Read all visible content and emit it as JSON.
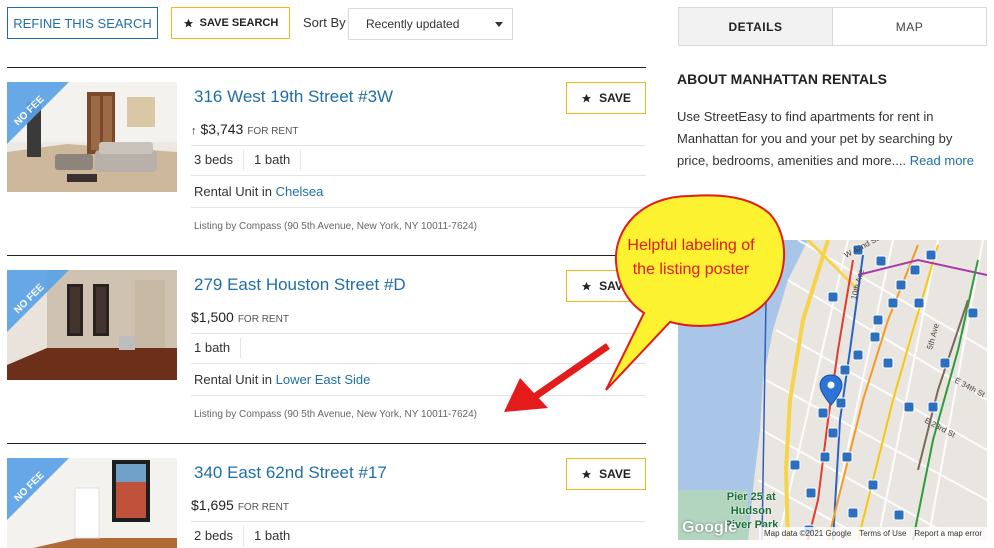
{
  "toolbar": {
    "refine_label": "REFINE THIS SEARCH",
    "save_search_label": "SAVE SEARCH",
    "sort_by_label": "Sort By",
    "sort_selected": "Recently updated"
  },
  "listings": [
    {
      "badge": "NO FEE",
      "title": "316 West 19th Street #3W",
      "price_arrow": "↑",
      "price": "$3,743",
      "price_suffix": "FOR RENT",
      "beds": "3 beds",
      "baths": "1 bath",
      "unit_prefix": "Rental Unit in",
      "neighborhood": "Chelsea",
      "listed_by": "Listing by Compass (90 5th Avenue, New York, NY 10011-7624)",
      "save_label": "SAVE"
    },
    {
      "badge": "NO FEE",
      "title": "279 East Houston Street #D",
      "price": "$1,500",
      "price_suffix": "FOR RENT",
      "baths": "1 bath",
      "unit_prefix": "Rental Unit in",
      "neighborhood": "Lower East Side",
      "listed_by": "Listing by Compass (90 5th Avenue, New York, NY 10011-7624)",
      "save_label": "SAVE"
    },
    {
      "badge": "NO FEE",
      "title": "340 East 62nd Street #17",
      "price": "$1,695",
      "price_suffix": "FOR RENT",
      "beds": "2 beds",
      "baths": "1 bath",
      "save_label": "SAVE"
    }
  ],
  "side": {
    "tabs": [
      {
        "label": "DETAILS",
        "active": true
      },
      {
        "label": "MAP",
        "active": false
      }
    ],
    "about_title": "ABOUT MANHATTAN RENTALS",
    "about_text": "Use StreetEasy to find apartments for rent in Manhattan for you and your pet by searching by price, bedrooms, amenities and more....",
    "read_more": "Read more"
  },
  "map": {
    "place_label_line1": "Pier 25 at",
    "place_label_line2": "Hudson",
    "place_label_line3": "River Park",
    "street_labels": [
      "W 42nd St",
      "10th Ave",
      "5th Ave",
      "E 34th St",
      "E 23rd St"
    ],
    "google_logo": "Google",
    "footer_data": "Map data ©2021 Google",
    "footer_terms": "Terms of Use",
    "footer_report": "Report a map error"
  },
  "annotation": {
    "text": "Helpful labeling of the listing poster"
  },
  "colors": {
    "accent_blue": "#1f6fa6",
    "save_border": "#f0b91a",
    "annotation_red": "#e41b1b",
    "annotation_yellow": "#fdf22f"
  },
  "icons": {
    "star": "star-icon",
    "caret": "chevron-down-icon",
    "map_pin": "map-pin-icon"
  }
}
